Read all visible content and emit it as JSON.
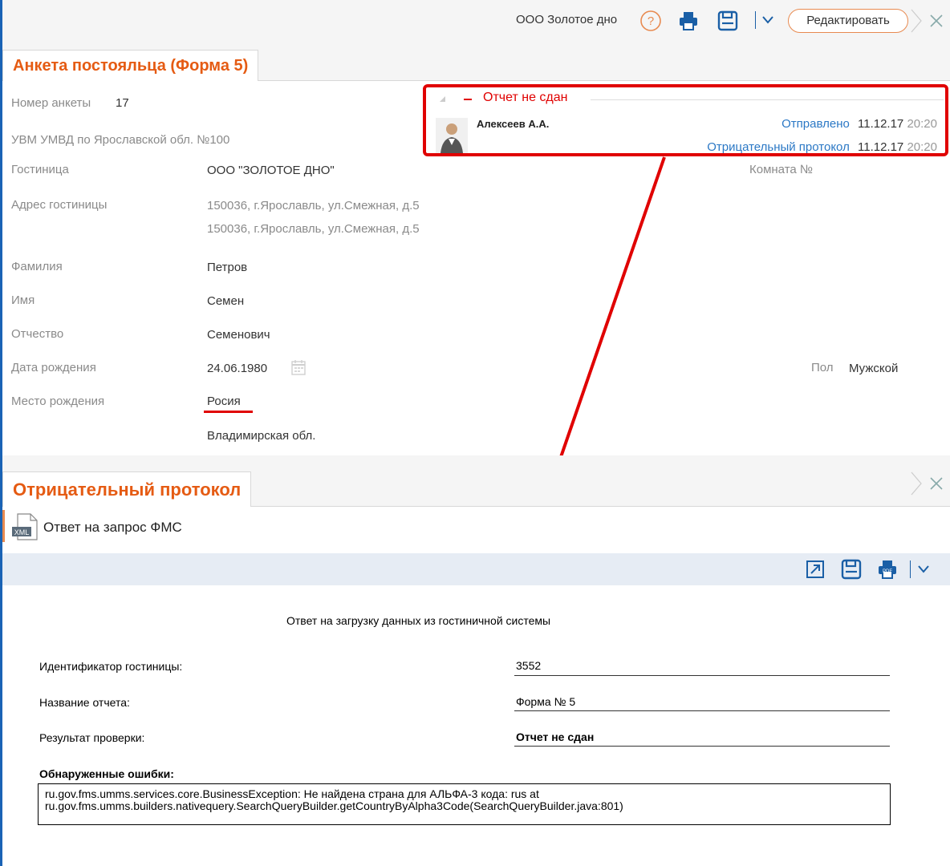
{
  "header": {
    "org_name": "ООО Золотое дно",
    "edit_label": "Редактировать"
  },
  "form": {
    "tab_title": "Анкета постояльца (Форма 5)",
    "number_label": "Номер анкеты",
    "number_value": "17",
    "authority": "УВМ УМВД по Ярославской обл. №100",
    "hotel_label": "Гостиница",
    "hotel_value": "ООО \"ЗОЛОТОЕ ДНО\"",
    "room_label": "Комната №",
    "address_label": "Адрес гостиницы",
    "address_line1": "150036, г.Ярославль, ул.Смежная, д.5",
    "address_line2": "150036, г.Ярославль, ул.Смежная, д.5",
    "surname_label": "Фамилия",
    "surname_value": "Петров",
    "name_label": "Имя",
    "name_value": "Семен",
    "patronymic_label": "Отчество",
    "patronymic_value": "Семенович",
    "birthdate_label": "Дата рождения",
    "birthdate_value": "24.06.1980",
    "gender_label": "Пол",
    "gender_value": "Мужской",
    "birthplace_label": "Место рождения",
    "birthplace_country": "Росия",
    "birthplace_region": "Владимирская обл."
  },
  "status": {
    "title": "Отчет не сдан",
    "user": "Алексеев А.А.",
    "sent_label": "Отправлено",
    "sent_date": "11.12.17",
    "sent_time": "20:20",
    "protocol_label": "Отрицательный протокол",
    "protocol_date": "11.12.17",
    "protocol_time": "20:20"
  },
  "protocol": {
    "tab_title": "Отрицательный протокол",
    "file_label": "Ответ на запрос ФМС"
  },
  "report": {
    "title": "Ответ на загрузку данных из гостиничной системы",
    "hotel_id_label": "Идентификатор гостиницы:",
    "hotel_id_value": "3552",
    "report_name_label": "Название отчета:",
    "report_name_value": "Форма № 5",
    "result_label": "Результат проверки:",
    "result_value": "Отчет не сдан",
    "errors_label": "Обнаруженные ошибки:",
    "error_line1": "ru.gov.fms.umms.services.core.BusinessException: Не найдена страна для АЛЬФА-3 кода: rus at",
    "error_line2": "ru.gov.fms.umms.builders.nativequery.SearchQueryBuilder.getCountryByAlpha3Code(SearchQueryBuilder.java:801)"
  },
  "colors": {
    "accent": "#e55b13",
    "link": "#2b78c5",
    "highlight": "#e00000"
  }
}
